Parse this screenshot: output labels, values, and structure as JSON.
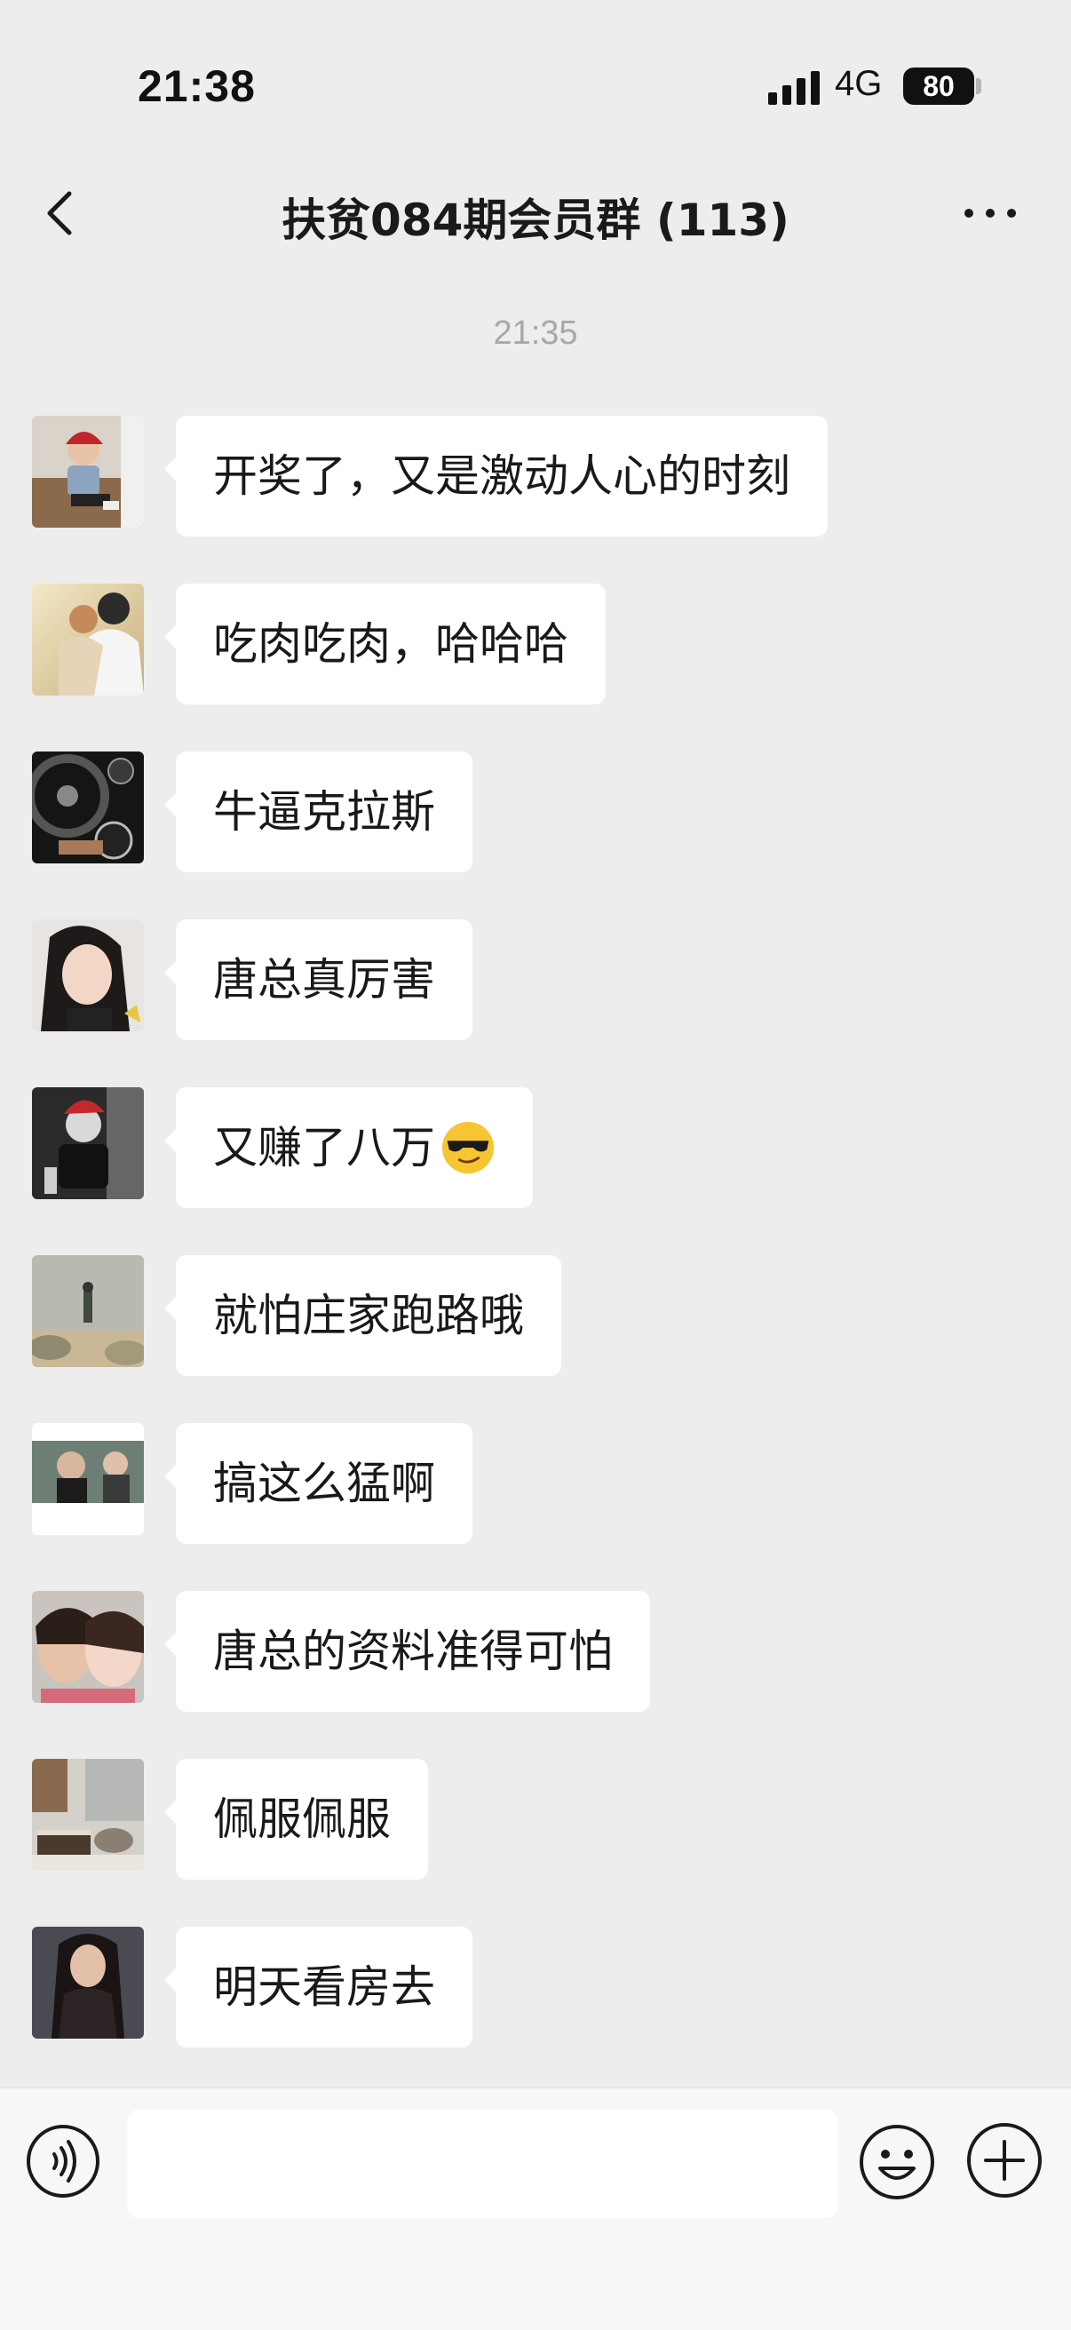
{
  "status_bar": {
    "time": "21:38",
    "network": "4G",
    "battery": "80"
  },
  "header": {
    "title": "扶贫084期会员群 (113)",
    "back_icon": "chevron-left-icon",
    "more_icon": "more-dots-icon"
  },
  "chat": {
    "timestamp": "21:35",
    "messages": [
      {
        "text": "开奖了，又是激动人心的时刻",
        "avatar": "boy-red-hat"
      },
      {
        "text": "吃肉吃肉，哈哈哈",
        "avatar": "couple-sunset"
      },
      {
        "text": "牛逼克拉斯",
        "avatar": "car-wheel-watch"
      },
      {
        "text": "唐总真厉害",
        "avatar": "woman-selfie"
      },
      {
        "text": "又赚了八万",
        "avatar": "man-santa-hat",
        "emoji": "sunglasses-emoji"
      },
      {
        "text": "就怕庄家跑路哦",
        "avatar": "person-landscape"
      },
      {
        "text": "搞这么猛啊",
        "avatar": "couple-scene"
      },
      {
        "text": "唐总的资料准得可怕",
        "avatar": "couple-closeup"
      },
      {
        "text": "佩服佩服",
        "avatar": "book-coffee"
      },
      {
        "text": "明天看房去",
        "avatar": "woman-dark"
      }
    ]
  },
  "input_bar": {
    "value": "",
    "voice_icon": "voice-icon",
    "emoji_icon": "emoji-icon",
    "plus_icon": "plus-icon"
  },
  "colors": {
    "background": "#ededed",
    "bubble": "#ffffff",
    "input_bar": "#f7f7f7",
    "timestamp": "#a8a8a8"
  }
}
